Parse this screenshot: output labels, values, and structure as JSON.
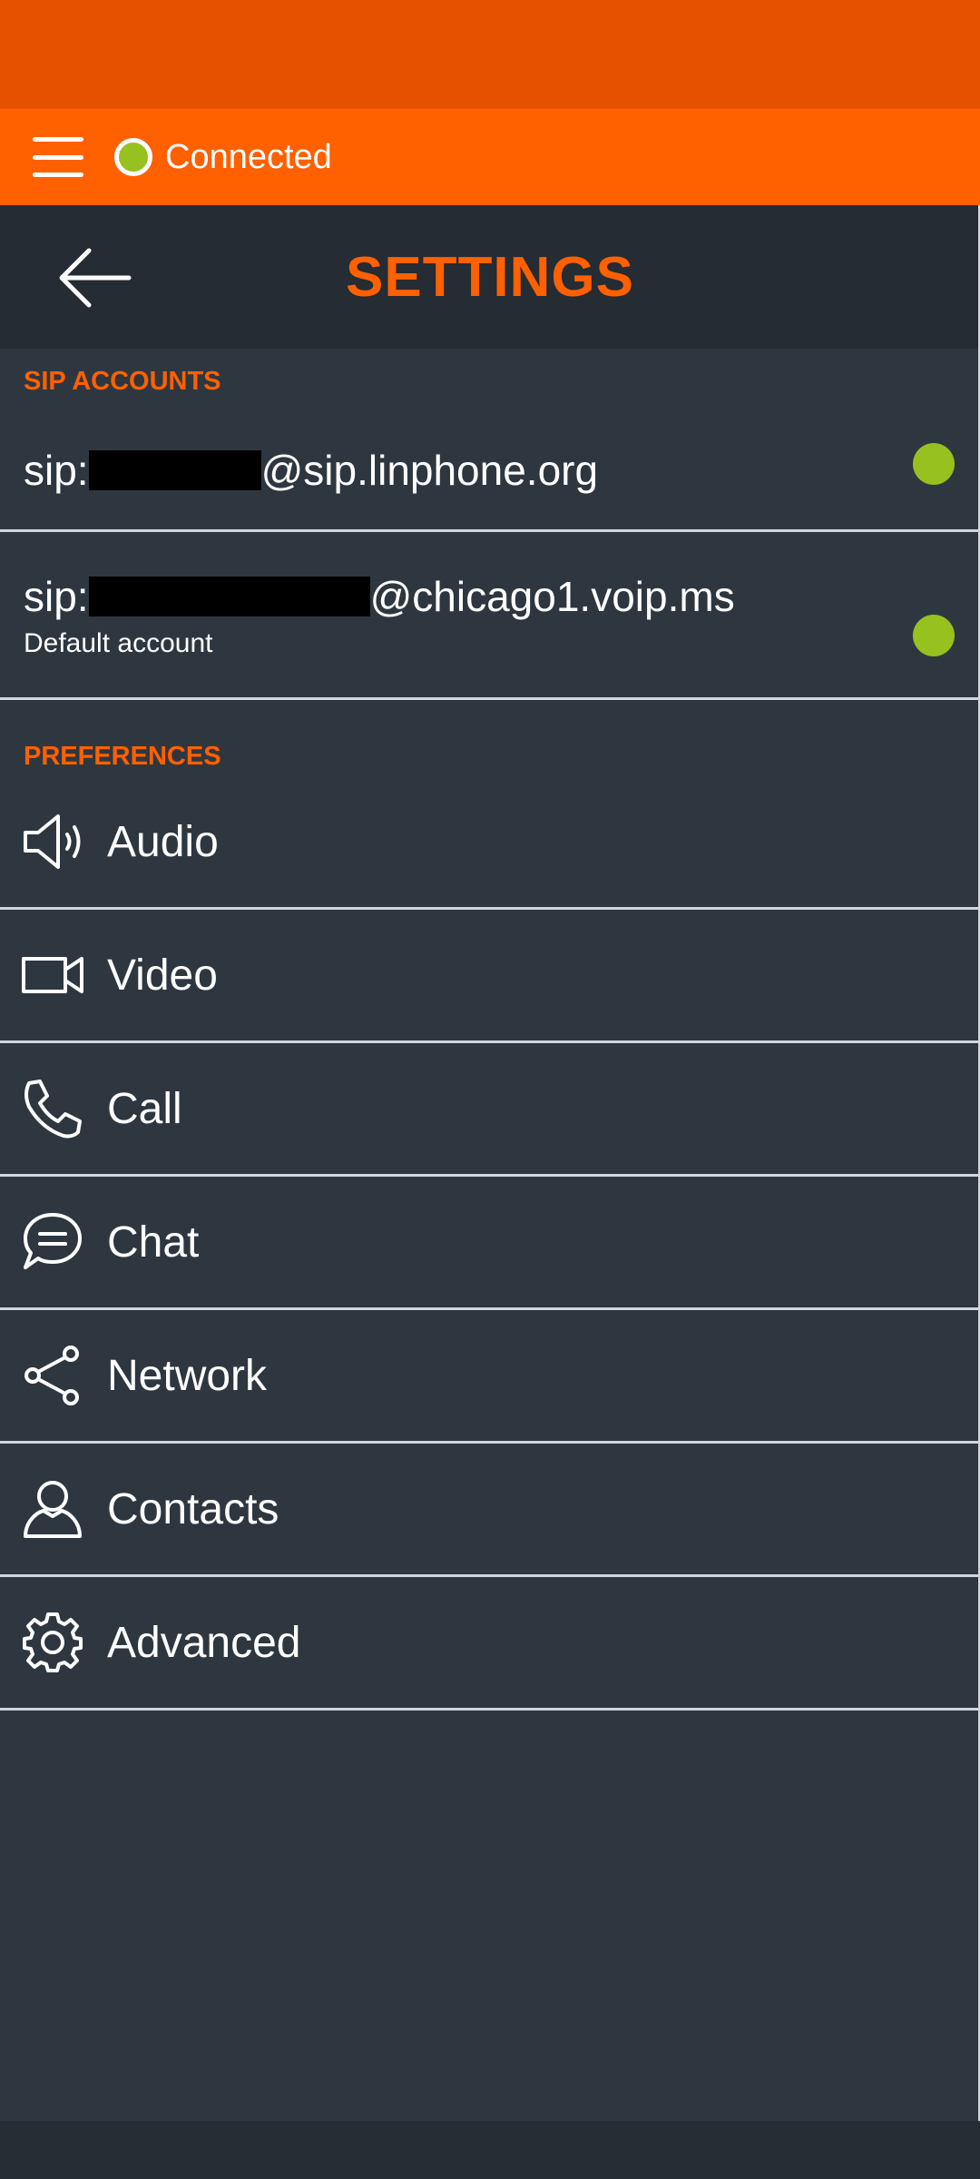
{
  "top_bar": {
    "status_text": "Connected",
    "status_color": "#97c11f",
    "accent": "#ff6000"
  },
  "header": {
    "title": "SETTINGS"
  },
  "sip_section": {
    "title": "SIP ACCOUNTS",
    "accounts": [
      {
        "prefix": "sip:",
        "domain": "@sip.linphone.org",
        "subtitle": "",
        "status": "connected"
      },
      {
        "prefix": "sip:",
        "domain": "@chicago1.voip.ms",
        "subtitle": "Default account",
        "status": "connected"
      }
    ]
  },
  "preferences": {
    "title": "PREFERENCES",
    "items": [
      {
        "label": "Audio",
        "icon": "speaker-icon"
      },
      {
        "label": "Video",
        "icon": "video-camera-icon"
      },
      {
        "label": "Call",
        "icon": "phone-icon"
      },
      {
        "label": "Chat",
        "icon": "chat-bubble-icon"
      },
      {
        "label": "Network",
        "icon": "share-network-icon"
      },
      {
        "label": "Contacts",
        "icon": "person-icon"
      },
      {
        "label": "Advanced",
        "icon": "gear-icon"
      }
    ]
  }
}
